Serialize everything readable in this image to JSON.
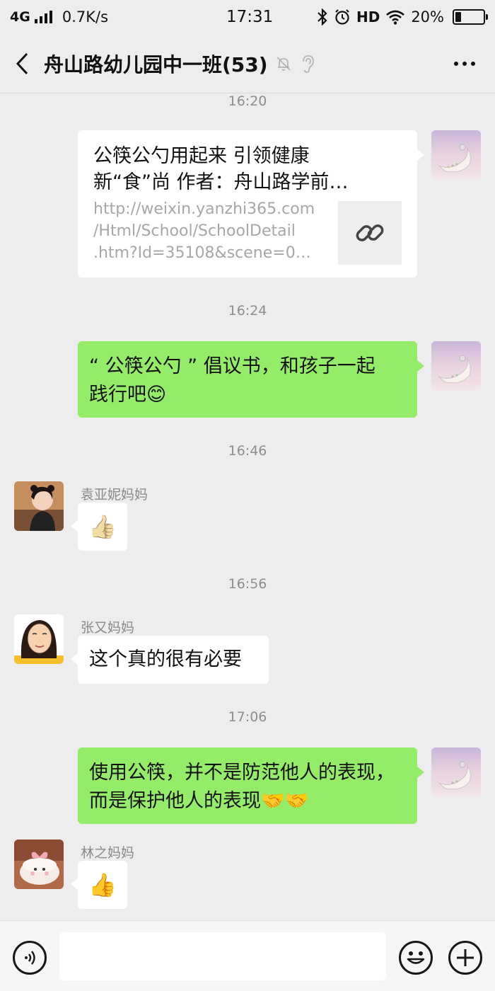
{
  "status_bar": {
    "network": "4G",
    "speed": "0.7K/s",
    "time": "17:31",
    "hd": "HD",
    "battery": "20%",
    "battery_level": 0.2
  },
  "header": {
    "title": "舟山路幼儿园中一班(53)"
  },
  "messages": {
    "ts1": "16:20",
    "card": {
      "title_line1": "公筷公勺用起来 引领健康",
      "title_line2": "新“食”尚 作者：舟山路学前…",
      "url_line1": "http://weixin.yanzhi365.com",
      "url_line2": "/Html/School/SchoolDetail",
      "url_line3": ".htm?Id=35108&scene=0…"
    },
    "ts2": "16:24",
    "msg2_line1": "“ 公筷公勺 ” 倡议书，和孩子一起",
    "msg2_line2": "践行吧😊",
    "ts3": "16:46",
    "sender3": "袁亚妮妈妈",
    "msg3": "👍",
    "ts4": "16:56",
    "sender4": "张又妈妈",
    "msg4": "这个真的很有必要",
    "ts5": "17:06",
    "msg5_line1": "使用公筷，并不是防范他人的表现，",
    "msg5_line2": "而是保护他人的表现🤝🤝",
    "sender6": "林之妈妈",
    "msg6": "👍"
  },
  "input_bar": {
    "value": ""
  },
  "colors": {
    "background": "#ededed",
    "bubble_green": "#95ec69",
    "bubble_white": "#ffffff"
  }
}
